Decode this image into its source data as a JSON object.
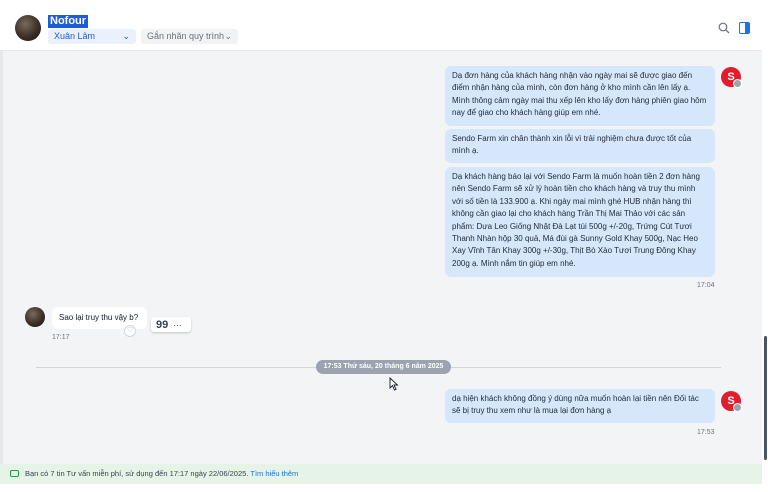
{
  "header": {
    "contact_name": "Nofour",
    "agent_select": "Xuân Lâm",
    "tag_select": "Gắn nhãn quy trình"
  },
  "messages": {
    "out1": "Dạ đơn hàng của khách hàng nhận vào ngày mai sẽ được giao đến điểm nhận hàng của mình, còn đơn hàng ở kho mình cần lên lấy ạ. Mình thông cảm ngày mai thu xếp lên kho lấy đơn hàng phiên giao hôm nay để giao cho khách hàng giúp em nhé.",
    "out2": "Sendo Farm xin chân thành xin lỗi vì trải nghiệm chưa được tốt của mình ạ.",
    "out3": "Dạ khách hàng báo lại với Sendo Farm là muốn hoàn tiền 2 đơn hàng nên Sendo Farm sẽ xử lý hoàn tiền cho khách hàng và truy thu mình với số tiền là 133.900 ạ. Khi ngày mai mình ghé HUB nhận hàng thì không cần giao lại cho khách hàng Trần Thị Mai Thảo với các sản phẩm: Dưa Leo Giống Nhật Đà Lạt túi 500g +/-20g, Trứng Cút Tươi Thanh Nhàn hộp 30 quả, Má đùi gà Sunny Gold Khay 500g, Nạc Heo Xay Vĩnh Tân Khay 300g +/-30g, Thịt Bò Xào Tươi Trung Đông Khay 200g ạ. Mình nắm tin giúp em nhé.",
    "out1_time": "17:04",
    "in1": "Sao lại truy thu vậy b?",
    "in1_time": "17:17",
    "date_divider": "17:53 Thứ sáu, 20 tháng 6 năm 2025",
    "out4": "dạ hiện khách không đồng ý dùng nữa muốn hoàn lại tiền nên Đối tác sẽ bị truy thu xem như là mua lại đơn hàng ạ",
    "out4_time": "17:53"
  },
  "icons": {
    "shop_avatar_letter": "S",
    "heart": "♡",
    "quote": "99",
    "more": "…"
  },
  "footer": {
    "text": "Bạn có 7 tin Tư vấn miễn phí, sử dụng đến 17:17 ngày 22/06/2025.",
    "link": "Tìm hiểu thêm"
  },
  "colors": {
    "accent": "#1a73e8",
    "outgoing_bubble": "#d7e7fb",
    "shop_brand": "#e11d2d",
    "footer_bg": "#e6f4e7"
  }
}
